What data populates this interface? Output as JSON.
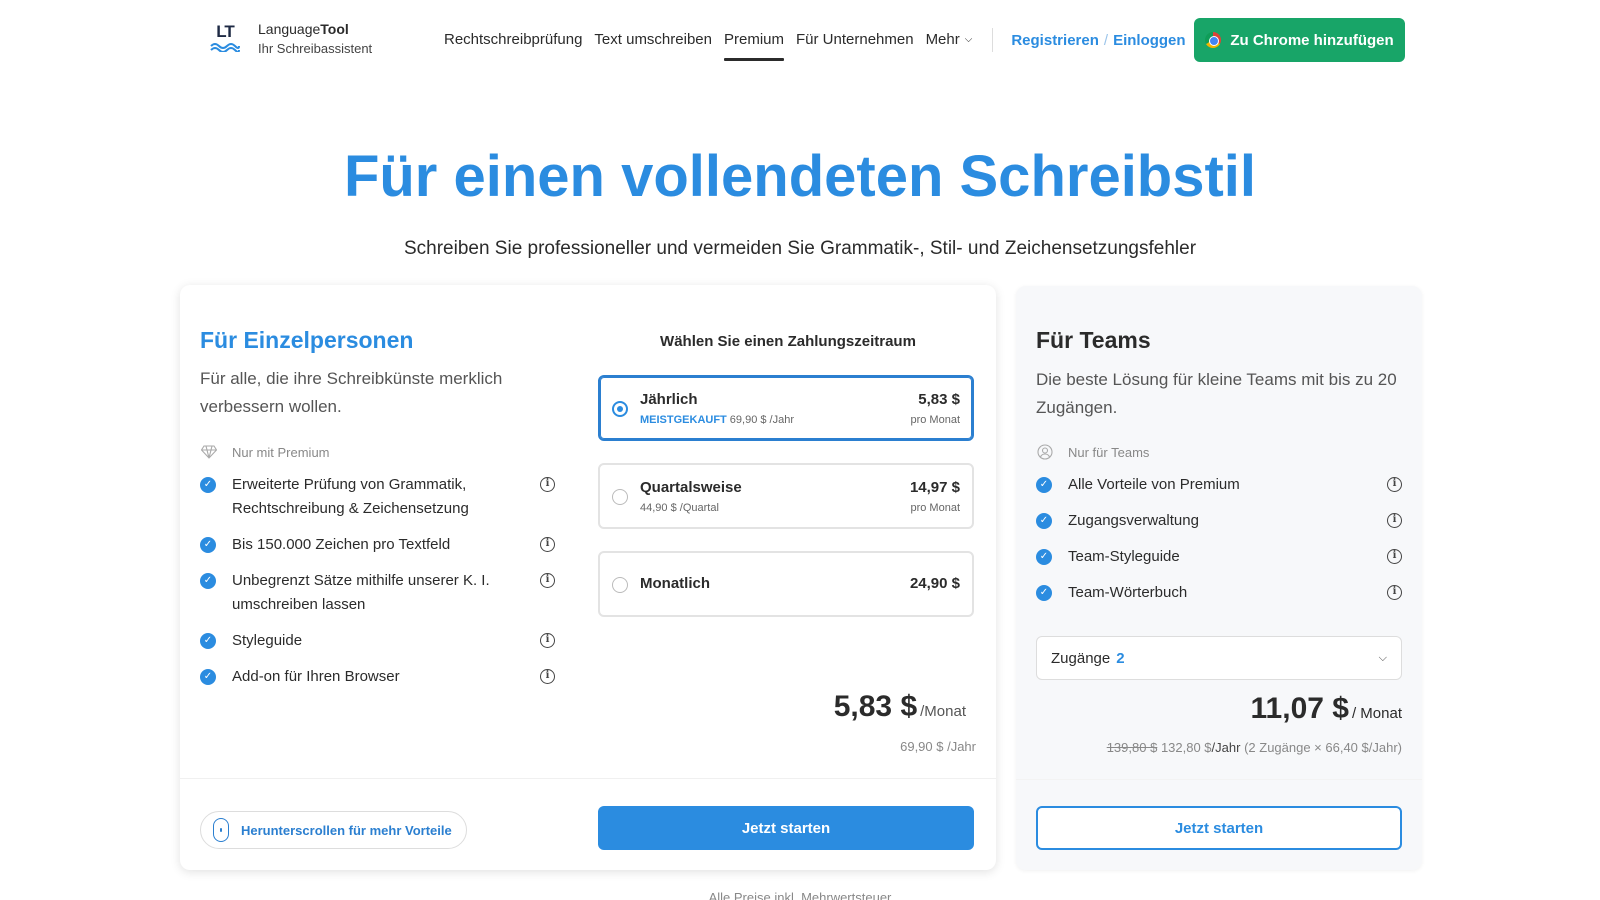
{
  "header": {
    "logo_mark": "LT",
    "brand_first": "Language",
    "brand_second": "Tool",
    "tagline": "Ihr Schreibassistent",
    "nav": [
      {
        "label": "Rechtschreibprüfung"
      },
      {
        "label": "Text umschreiben"
      },
      {
        "label": "Premium",
        "active": true
      },
      {
        "label": "Für Unternehmen"
      },
      {
        "label": "Mehr"
      }
    ],
    "register_label": "Registrieren",
    "login_label": "Einloggen",
    "chrome_button_label": "Zu Chrome hinzufügen"
  },
  "hero": {
    "title": "Für einen vollendeten Schreibstil",
    "subtitle": "Schreiben Sie professioneller und vermeiden Sie Grammatik-, Stil- und Zeichensetzungsfehler"
  },
  "individual": {
    "heading": "Für Einzelpersonen",
    "description": "Für alle, die ihre Schreibkünste merklich verbessern wollen.",
    "features_heading": "Nur mit Premium",
    "features": [
      "Erweiterte Prüfung von Grammatik, Rechtschreibung & Zeichensetzung",
      "Bis 150.000 Zeichen pro Textfeld",
      "Unbegrenzt Sätze mithilfe unserer K. I. umschreiben lassen",
      "Styleguide",
      "Add-on für Ihren Browser"
    ],
    "period_title": "Wählen Sie einen Zahlungszeitraum",
    "plans": [
      {
        "name": "Jährlich",
        "badge": "MEISTGEKAUFT",
        "sub": "69,90 $ /Jahr",
        "price": "5,83 $",
        "per": "pro Monat",
        "selected": true
      },
      {
        "name": "Quartalsweise",
        "badge": "",
        "sub": "44,90 $ /Quartal",
        "price": "14,97 $",
        "per": "pro Monat",
        "selected": false
      },
      {
        "name": "Monatlich",
        "badge": "",
        "sub": "",
        "price": "24,90 $",
        "per": "",
        "selected": false
      }
    ],
    "total_price": "5,83 $",
    "total_unit": "/Monat",
    "total_sub": "69,90 $ /Jahr",
    "scroll_hint": "Herunterscrollen für mehr Vorteile",
    "start_label": "Jetzt starten"
  },
  "teams": {
    "heading": "Für Teams",
    "description": "Die beste Lösung für kleine Teams mit bis zu 20 Zugängen.",
    "features_heading": "Nur für Teams",
    "features": [
      "Alle Vorteile von Premium",
      "Zugangsverwaltung",
      "Team-Styleguide",
      "Team-Wörterbuch"
    ],
    "select_label": "Zugänge",
    "select_value": "2",
    "price": "11,07 $",
    "price_unit": "/ Monat",
    "old_price": "139,80 $",
    "new_price": "132,80 $",
    "per_year": "/Jahr",
    "breakdown": "(2 Zugänge × 66,40 $/Jahr)",
    "start_label": "Jetzt starten"
  },
  "footnote": "Alle Preise inkl. Mehrwertsteuer",
  "colors": {
    "accent": "#2b8ce0",
    "chrome_button": "#18a568",
    "text": "#2b2b2b"
  }
}
